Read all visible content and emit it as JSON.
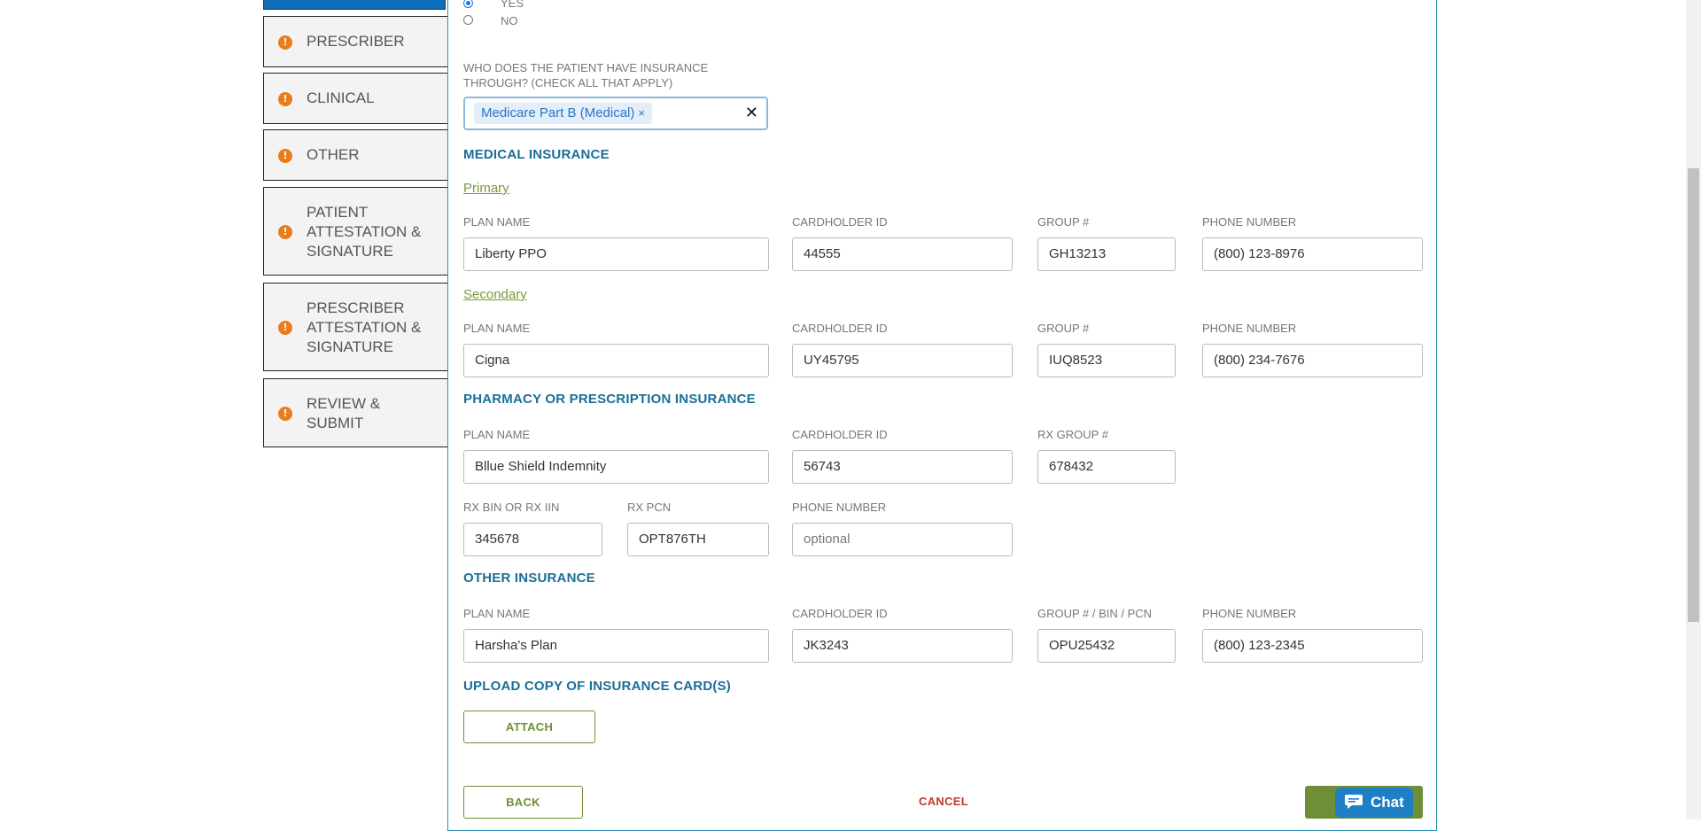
{
  "sidebar": {
    "items": [
      {
        "label": "PRESCRIBER"
      },
      {
        "label": "CLINICAL"
      },
      {
        "label": "OTHER"
      },
      {
        "label": "PATIENT ATTESTATION & SIGNATURE"
      },
      {
        "label": "PRESCRIBER ATTESTATION & SIGNATURE"
      },
      {
        "label": "REVIEW & SUBMIT"
      }
    ],
    "warning_glyph": "!"
  },
  "radio": {
    "yes_label": "YES",
    "no_label": "NO",
    "selected": "YES"
  },
  "insurance_question": "WHO DOES THE PATIENT HAVE INSURANCE THROUGH? (CHECK ALL THAT APPLY)",
  "insurance_selected": {
    "tag": "Medicare Part B (Medical)",
    "tag_remove": "×",
    "clear": "✕"
  },
  "medical": {
    "title": "MEDICAL INSURANCE",
    "labels": {
      "plan_name": "PLAN NAME",
      "cardholder_id": "CARDHOLDER ID",
      "group": "GROUP #",
      "phone": "PHONE NUMBER"
    },
    "primary": {
      "title": "Primary",
      "plan_name": "Liberty PPO",
      "cardholder_id": "44555",
      "group": "GH13213",
      "phone": "(800) 123-8976"
    },
    "secondary": {
      "title": "Secondary",
      "plan_name": "Cigna",
      "cardholder_id": "UY45795",
      "group": "IUQ8523",
      "phone": "(800) 234-7676"
    }
  },
  "pharmacy": {
    "title": "PHARMACY OR PRESCRIPTION INSURANCE",
    "labels": {
      "plan_name": "PLAN NAME",
      "cardholder_id": "CARDHOLDER ID",
      "rx_group": "RX GROUP #",
      "rx_bin": "RX BIN OR RX IIN",
      "rx_pcn": "RX PCN",
      "phone": "PHONE NUMBER"
    },
    "plan_name": "Bllue Shield Indemnity",
    "cardholder_id": "56743",
    "rx_group": "678432",
    "rx_bin": "345678",
    "rx_pcn": "OPT876TH",
    "phone_placeholder": "optional"
  },
  "other": {
    "title": "OTHER INSURANCE",
    "labels": {
      "plan_name": "PLAN NAME",
      "cardholder_id": "CARDHOLDER ID",
      "group": "GROUP # / BIN / PCN",
      "phone": "PHONE NUMBER"
    },
    "plan_name": "Harsha's Plan",
    "cardholder_id": "JK3243",
    "group": "OPU25432",
    "phone": "(800) 123-2345"
  },
  "upload": {
    "title": "UPLOAD COPY OF INSURANCE CARD(S)",
    "attach_label": "ATTACH"
  },
  "footer": {
    "back_label": "BACK",
    "cancel_label": "CANCEL",
    "chat_label": "Chat"
  },
  "colors": {
    "accent_blue": "#1a6f96",
    "sidebar_active": "#0f6eb7",
    "warning_orange": "#e97d1e",
    "button_green": "#6f8f37",
    "cancel_red": "#c0392b",
    "chat_blue": "#1f7fc4"
  }
}
